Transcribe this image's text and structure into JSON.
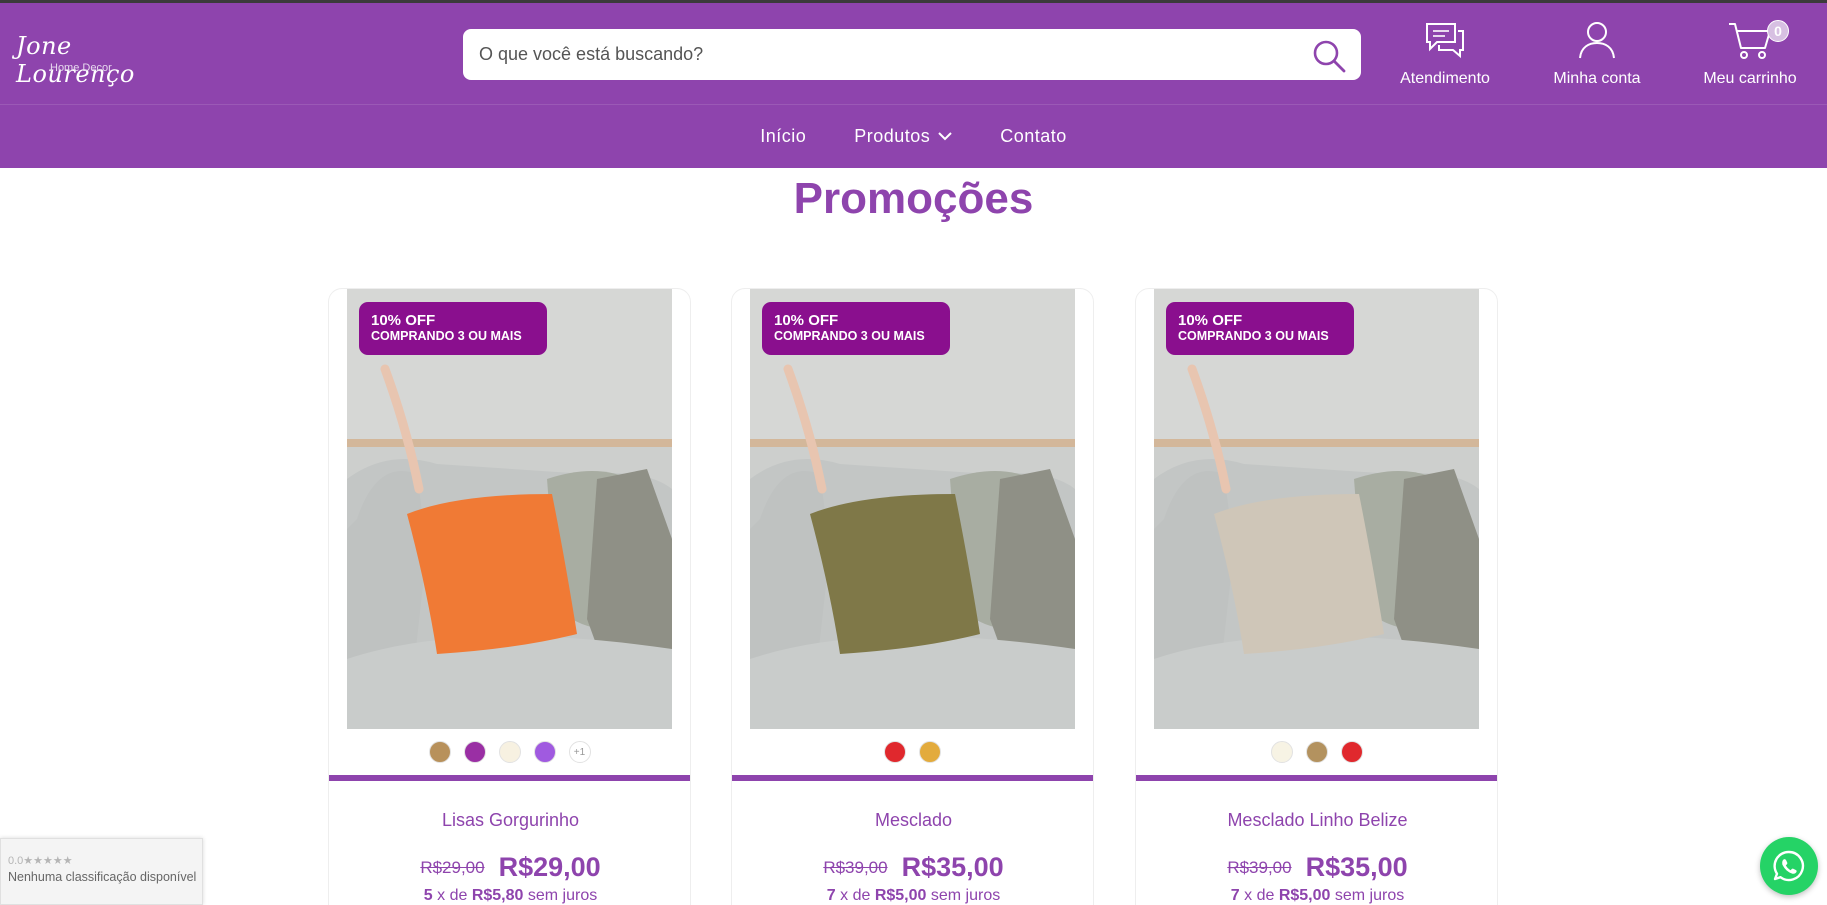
{
  "brand": {
    "logo_script": "Jone Lourenço",
    "logo_sub": "Home Decor"
  },
  "search": {
    "placeholder": "O que você está buscando?"
  },
  "header": {
    "support_label": "Atendimento",
    "account_label": "Minha conta",
    "cart_label": "Meu carrinho",
    "cart_count": "0"
  },
  "nav": {
    "items": [
      {
        "label": "Início"
      },
      {
        "label": "Produtos"
      },
      {
        "label": "Contato"
      }
    ]
  },
  "section": {
    "title": "Promoções"
  },
  "colors": {
    "brand": "#8e44ad",
    "promo_badge": "#8a0f8e",
    "whatsapp": "#25d366"
  },
  "products": [
    {
      "badge_line1": "10% OFF",
      "badge_line2": "COMPRANDO 3 OU MAIS",
      "name": "Lisas Gorgurinho",
      "old_price": "R$29,00",
      "price": "R$29,00",
      "inst_count": "5",
      "inst_text1": "x de",
      "inst_value": "R$5,80",
      "inst_text2": "sem juros",
      "pillow_color": "#f07a35",
      "swatches": [
        "#b8915b",
        "#9a2fa4",
        "#f7f1e1",
        "#a05ae0"
      ],
      "more_label": "+1"
    },
    {
      "badge_line1": "10% OFF",
      "badge_line2": "COMPRANDO 3 OU MAIS",
      "name": "Mesclado",
      "old_price": "R$39,00",
      "price": "R$35,00",
      "inst_count": "7",
      "inst_text1": "x de",
      "inst_value": "R$5,00",
      "inst_text2": "sem juros",
      "pillow_color": "#7f7848",
      "swatches": [
        "#e0282d",
        "#e3ab3c"
      ]
    },
    {
      "badge_line1": "10% OFF",
      "badge_line2": "COMPRANDO 3 OU MAIS",
      "name": "Mesclado Linho Belize",
      "old_price": "R$39,00",
      "price": "R$35,00",
      "inst_count": "7",
      "inst_text1": "x de",
      "inst_value": "R$5,00",
      "inst_text2": "sem juros",
      "pillow_color": "#cfc6b8",
      "swatches": [
        "#f7f3e4",
        "#b3925f",
        "#e0282d"
      ]
    }
  ],
  "rating_widget": {
    "stars_text": "0.0★★★★★",
    "text": "Nenhuma classificação disponível"
  },
  "icons": {
    "search": "search-icon",
    "support": "chat-bubbles-icon",
    "account": "user-icon",
    "cart": "cart-icon",
    "dropdown": "chevron-down-icon",
    "whatsapp": "whatsapp-icon"
  }
}
